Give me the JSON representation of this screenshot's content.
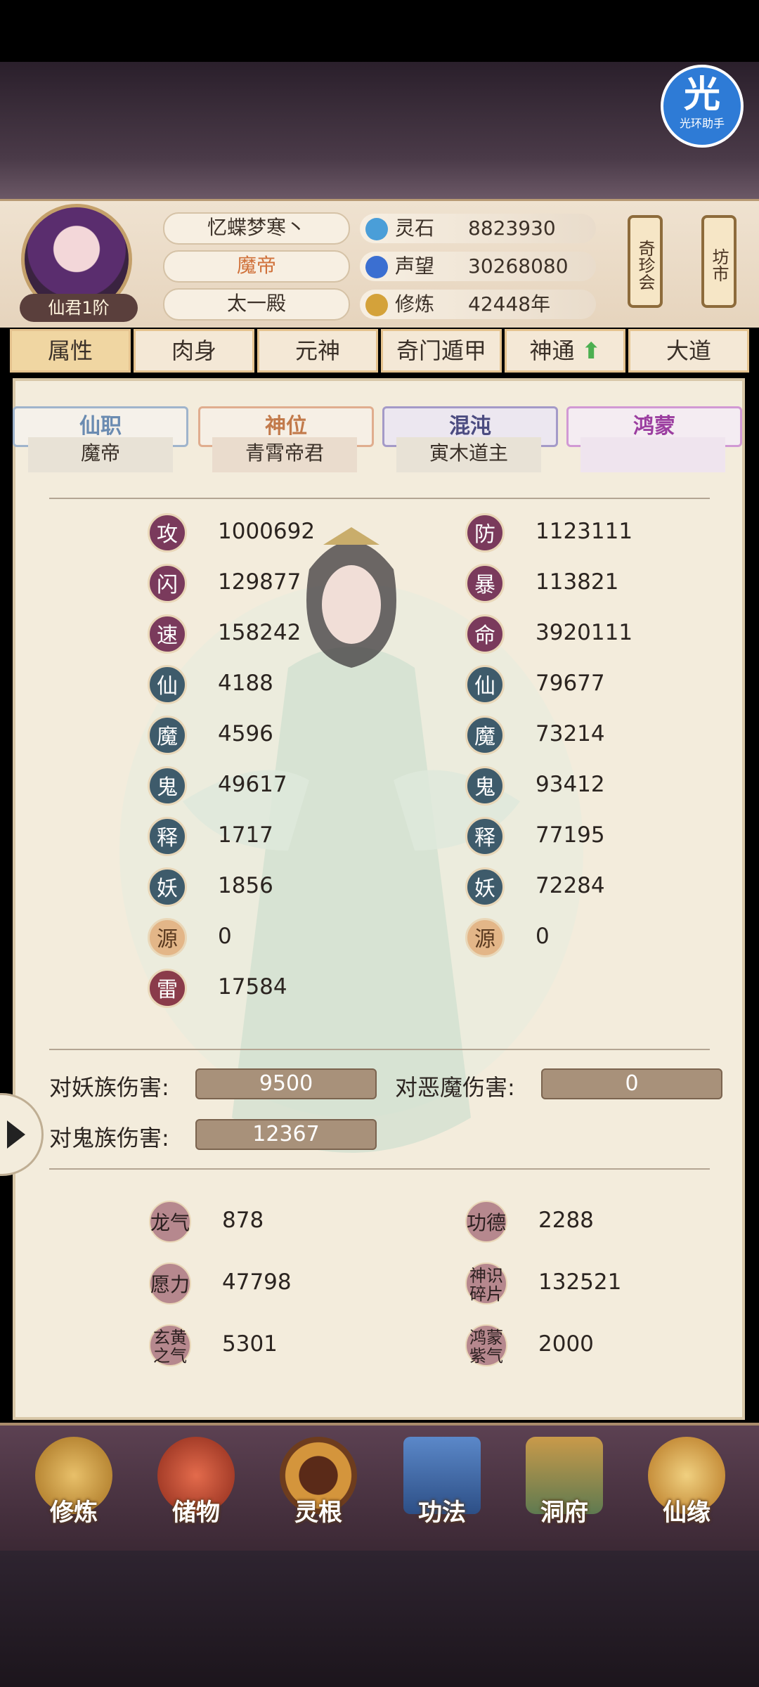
{
  "badge": {
    "glyph": "光",
    "text": "光环助手"
  },
  "profile": {
    "name": "忆蝶梦寒丶",
    "title": "魔帝",
    "sect": "太一殿",
    "rank": "仙君1阶"
  },
  "resources": [
    {
      "label": "灵石",
      "value": "8823930",
      "icon": "spirit-stone-icon",
      "color": "#4a9ed8"
    },
    {
      "label": "声望",
      "value": "30268080",
      "icon": "prestige-drop-icon",
      "color": "#3b6fd1"
    },
    {
      "label": "修炼",
      "value": "42448年",
      "icon": "meditation-icon",
      "color": "#d4a23a"
    }
  ],
  "side_buttons": [
    {
      "label": "奇珍会"
    },
    {
      "label": "坊市"
    }
  ],
  "tabs": [
    {
      "label": "属性"
    },
    {
      "label": "肉身"
    },
    {
      "label": "元神"
    },
    {
      "label": "奇门遁甲"
    },
    {
      "label": "神通",
      "arrow": "⬆"
    },
    {
      "label": "大道"
    }
  ],
  "position_tabs": [
    {
      "label": "仙职",
      "value": "魔帝",
      "color": "#6a8bb1"
    },
    {
      "label": "神位",
      "value": "青霄帝君",
      "color": "#c27a4b"
    },
    {
      "label": "混沌",
      "value": "寅木道主",
      "color": "#4b4b80"
    },
    {
      "label": "鸿蒙",
      "value": "",
      "color": "#9b3ea0"
    }
  ],
  "stats_left": [
    {
      "icon": "攻",
      "value": "1000692",
      "color": "#7a3a5c"
    },
    {
      "icon": "闪",
      "value": "129877",
      "color": "#7a3a5c"
    },
    {
      "icon": "速",
      "value": "158242",
      "color": "#7a3a5c"
    },
    {
      "icon": "仙",
      "value": "4188",
      "color": "#3e5b6b"
    },
    {
      "icon": "魔",
      "value": "4596",
      "color": "#3e5b6b"
    },
    {
      "icon": "鬼",
      "value": "49617",
      "color": "#3e5b6b"
    },
    {
      "icon": "释",
      "value": "1717",
      "color": "#3e5b6b"
    },
    {
      "icon": "妖",
      "value": "1856",
      "color": "#3e5b6b"
    },
    {
      "icon": "源",
      "value": "0",
      "color": "#e3b688"
    },
    {
      "icon": "雷",
      "value": "17584",
      "color": "#8a3b4a"
    }
  ],
  "stats_right": [
    {
      "icon": "防",
      "value": "1123111",
      "color": "#7a3a5c"
    },
    {
      "icon": "暴",
      "value": "113821",
      "color": "#7a3a5c"
    },
    {
      "icon": "命",
      "value": "3920111",
      "color": "#7a3a5c"
    },
    {
      "icon": "仙",
      "value": "79677",
      "color": "#3e5b6b"
    },
    {
      "icon": "魔",
      "value": "73214",
      "color": "#3e5b6b"
    },
    {
      "icon": "鬼",
      "value": "93412",
      "color": "#3e5b6b"
    },
    {
      "icon": "释",
      "value": "77195",
      "color": "#3e5b6b"
    },
    {
      "icon": "妖",
      "value": "72284",
      "color": "#3e5b6b"
    },
    {
      "icon": "源",
      "value": "0",
      "color": "#e3b688"
    }
  ],
  "damage": [
    {
      "label": "对妖族伤害:",
      "value": "9500"
    },
    {
      "label": "对恶魔伤害:",
      "value": "0"
    },
    {
      "label": "对鬼族伤害:",
      "value": "12367"
    }
  ],
  "extras_left": [
    {
      "icon": "龙气",
      "value": "878"
    },
    {
      "icon": "愿力",
      "value": "47798"
    },
    {
      "icon": "玄黄之气",
      "value": "5301"
    }
  ],
  "extras_right": [
    {
      "icon": "功德",
      "value": "2288"
    },
    {
      "icon": "神识碎片",
      "value": "132521"
    },
    {
      "icon": "鸿蒙紫气",
      "value": "2000"
    }
  ],
  "nav": [
    {
      "label": "修炼",
      "icon": "cultivate-figure-icon",
      "color": "#c99a3a"
    },
    {
      "label": "储物",
      "icon": "storage-bag-icon",
      "color": "#b9472f"
    },
    {
      "label": "灵根",
      "icon": "spirit-root-icon",
      "color": "#c5802e"
    },
    {
      "label": "功法",
      "icon": "technique-book-icon",
      "color": "#3d6aa6"
    },
    {
      "label": "洞府",
      "icon": "cave-dwelling-icon",
      "color": "#7a8b5a"
    },
    {
      "label": "仙缘",
      "icon": "immortal-fate-icon",
      "color": "#c58a2e"
    }
  ]
}
